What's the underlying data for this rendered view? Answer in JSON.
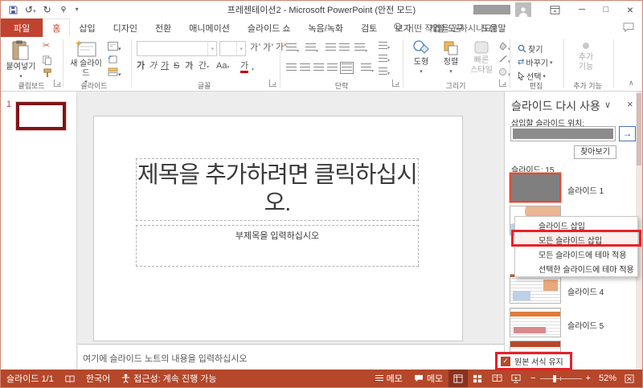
{
  "window": {
    "title": "프레젠테이션2 - Microsoft PowerPoint (안전 모드)"
  },
  "icons": {
    "undo": "↺",
    "redo": "↻",
    "qat_dropdown": "▾",
    "minimize": "─",
    "maximize": "□",
    "close": "×",
    "dropdown": "▾",
    "chevron_small": "⌄",
    "collapse_ribbon": "∧",
    "scissors": "✂",
    "pane_dropdown": "∨",
    "pane_close": "×",
    "go_arrow": "→",
    "check": "✓",
    "minus": "−",
    "plus": "+",
    "ga": "가",
    "strike_s": "S",
    "spacing": "간",
    "case_aa": "Aa",
    "swap": "⇄",
    "search": "⌕",
    "cursor": "▸"
  },
  "tabs": [
    {
      "label": "파일",
      "cls": "file"
    },
    {
      "label": "홈",
      "cls": "active"
    },
    {
      "label": "삽입"
    },
    {
      "label": "디자인"
    },
    {
      "label": "전환"
    },
    {
      "label": "애니메이션"
    },
    {
      "label": "슬라이드 쇼"
    },
    {
      "label": "녹음/녹화"
    },
    {
      "label": "검토"
    },
    {
      "label": "보기"
    },
    {
      "label": "개발 도구"
    },
    {
      "label": "도움말"
    }
  ],
  "tellme": "어떤 작업을 원하시나요?",
  "ribbon": {
    "paste": "붙여넣기",
    "new_slide": "새 슬라이드",
    "shapes": "도형",
    "arrange": "정렬",
    "quick_styles_1": "빠른",
    "quick_styles_2": "스타일",
    "find": "찾기",
    "replace": "바꾸기",
    "select": "선택",
    "addins_1": "추가",
    "addins_2": "기능",
    "groups": {
      "clipboard": "클립보드",
      "slides": "슬라이드",
      "font": "글꼴",
      "paragraph": "단락",
      "drawing": "그리기",
      "editing": "편집",
      "addins": "추가 기능"
    }
  },
  "thumb_panel": {
    "slide_number": "1"
  },
  "slide": {
    "title_placeholder": "제목을 추가하려면 클릭하십시오.",
    "subtitle_placeholder": "부제목을 입력하십시오"
  },
  "notes_placeholder": "여기에 슬라이드 노트의 내용을 입력하십시오",
  "reuse_pane": {
    "title": "슬라이드 다시 사용",
    "insert_from_label": "삽입할 슬라이드 위치:",
    "browse_button": "찾아보기",
    "slides_count": "슬라이드: 15",
    "slide_labels": {
      "s1": "슬라이드 1",
      "s4": "슬라이드 4",
      "s5": "슬라이드 5"
    },
    "context_menu": [
      {
        "label": "슬라이드 삽입"
      },
      {
        "label": "모든 슬라이드 삽입",
        "cls": "hl"
      },
      {
        "label": "모든 슬라이드에 테마 적용"
      },
      {
        "label": "선택한 슬라이드에 테마 적용"
      }
    ],
    "keep_formatting": "원본 서식 유지"
  },
  "status_bar": {
    "slide_counter": "슬라이드 1/1",
    "language": "한국어",
    "accessibility": "접근성: 계속 진행 가능",
    "notes_label": "메모",
    "comments_label": "메모",
    "zoom_level": "52%"
  },
  "colors": {
    "accent": "#c04330",
    "status_bar": "#b5472a",
    "annotation": "#e8202a",
    "selection": "#de4b32"
  }
}
